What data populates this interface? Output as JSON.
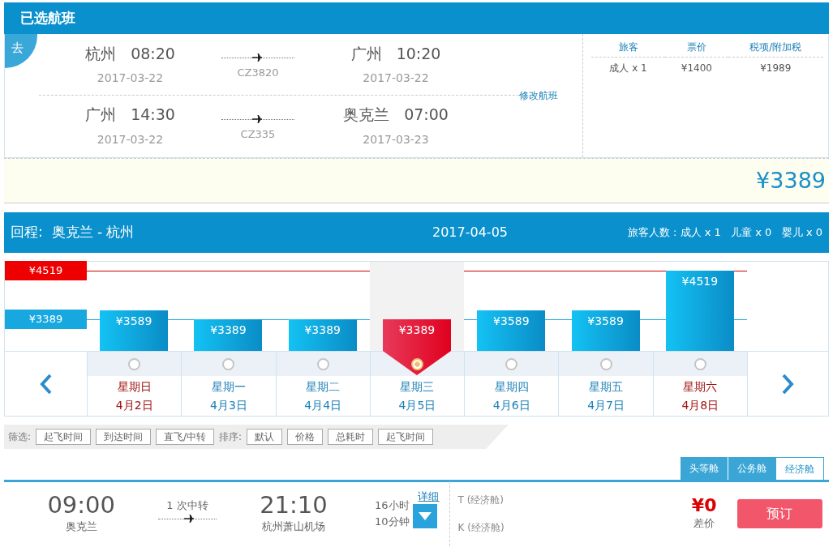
{
  "selected_flights": {
    "title": "已选航班",
    "direction_tag": "去",
    "change_link": "修改航班",
    "segments": [
      {
        "from_city": "杭州",
        "from_time": "08:20",
        "from_date": "2017-03-22",
        "flight_no": "CZ3820",
        "to_city": "广州",
        "to_time": "10:20",
        "to_date": "2017-03-22"
      },
      {
        "from_city": "广州",
        "from_time": "14:30",
        "from_date": "2017-03-22",
        "flight_no": "CZ335",
        "to_city": "奥克兰",
        "to_time": "07:00",
        "to_date": "2017-03-23"
      }
    ],
    "price_table": {
      "columns": [
        "旅客",
        "票价",
        "税项/附加税"
      ],
      "rows": [
        [
          "成人 x 1",
          "¥1400",
          "¥1989"
        ]
      ]
    },
    "total": "¥3389"
  },
  "return": {
    "label": "回程:",
    "route": "奥克兰 - 杭州",
    "date": "2017-04-05",
    "passengers": "旅客人数 : 成人 x 1   儿童 x 0   婴儿 x 0"
  },
  "calendar": {
    "max_line": {
      "label": "¥4519"
    },
    "min_line": {
      "label": "¥3389"
    },
    "days": [
      {
        "price": "¥3589",
        "weekday": "星期日",
        "date": "4月2日",
        "weekend": true,
        "selected": false
      },
      {
        "price": "¥3389",
        "weekday": "星期一",
        "date": "4月3日",
        "weekend": false,
        "selected": false
      },
      {
        "price": "¥3389",
        "weekday": "星期二",
        "date": "4月4日",
        "weekend": false,
        "selected": false
      },
      {
        "price": "¥3389",
        "weekday": "星期三",
        "date": "4月5日",
        "weekend": false,
        "selected": true
      },
      {
        "price": "¥3589",
        "weekday": "星期四",
        "date": "4月6日",
        "weekend": false,
        "selected": false
      },
      {
        "price": "¥3589",
        "weekday": "星期五",
        "date": "4月7日",
        "weekend": false,
        "selected": false
      },
      {
        "price": "¥4519",
        "weekday": "星期六",
        "date": "4月8日",
        "weekend": true,
        "selected": false
      }
    ]
  },
  "filter_bar": {
    "filter_label": "筛选:",
    "filters": [
      "起飞时间",
      "到达时间",
      "直飞/中转"
    ],
    "sort_label": "排序:",
    "sorts": [
      "默认",
      "价格",
      "总耗时",
      "起飞时间"
    ]
  },
  "cabin_tabs": [
    {
      "label": "头等舱",
      "selected": false
    },
    {
      "label": "公务舱",
      "selected": false
    },
    {
      "label": "经济舱",
      "selected": true
    }
  ],
  "flight": {
    "depart_time": "09:00",
    "depart_airport": "奥克兰",
    "stops": "1 次中转",
    "arrive_time": "21:10",
    "arrive_airport": "杭州萧山机场",
    "duration_hours": "16小时",
    "duration_minutes": "10分钟",
    "details": "详细",
    "fares": [
      {
        "code": "T",
        "cabin": "(经济舱)"
      },
      {
        "code": "K",
        "cabin": "(经济舱)"
      }
    ],
    "price_diff": "¥0",
    "price_diff_label": "差价",
    "book_button": "预订"
  }
}
